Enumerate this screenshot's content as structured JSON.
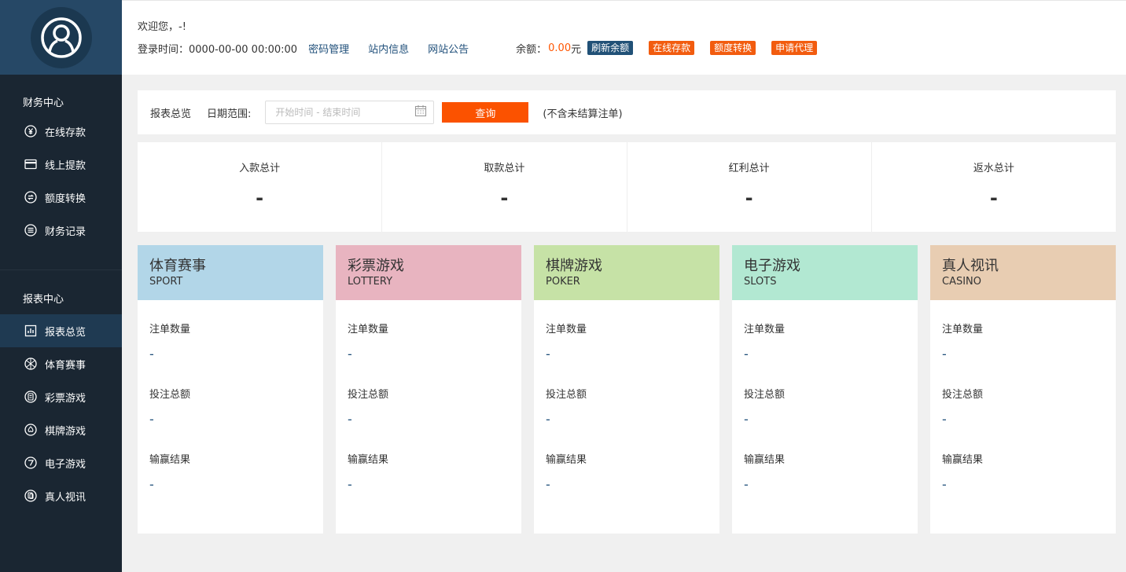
{
  "sidebar": {
    "finance_title": "财务中心",
    "finance_items": [
      {
        "label": "在线存款",
        "icon": "yen-circle-icon"
      },
      {
        "label": "线上提款",
        "icon": "card-icon"
      },
      {
        "label": "额度转换",
        "icon": "transfer-icon"
      },
      {
        "label": "财务记录",
        "icon": "list-circle-icon"
      }
    ],
    "report_title": "报表中心",
    "report_items": [
      {
        "label": "报表总览",
        "icon": "chart-icon"
      },
      {
        "label": "体育赛事",
        "icon": "ball-icon"
      },
      {
        "label": "彩票游戏",
        "icon": "lottery-icon"
      },
      {
        "label": "棋牌游戏",
        "icon": "spade-icon"
      },
      {
        "label": "电子游戏",
        "icon": "slot-icon"
      },
      {
        "label": "真人视讯",
        "icon": "casino-icon"
      }
    ]
  },
  "header": {
    "welcome": "欢迎您，-!",
    "login_time": "登录时间：0000-00-00 00:00:00",
    "links": [
      "密码管理",
      "站内信息",
      "网站公告"
    ],
    "balance_label": "余额：",
    "balance_amount": "0.00",
    "balance_unit": " 元",
    "refresh_btn": "刷新余额",
    "actions": [
      "在线存款",
      "额度转换",
      "申请代理"
    ]
  },
  "filter": {
    "title": "报表总览",
    "date_label": "日期范围:",
    "date_placeholder": "开始时间 - 结束时间",
    "query_btn": "查询",
    "note": "(不含未结算注单)"
  },
  "summary": [
    {
      "label": "入款总计",
      "value": "-"
    },
    {
      "label": "取款总计",
      "value": "-"
    },
    {
      "label": "红利总计",
      "value": "-"
    },
    {
      "label": "返水总计",
      "value": "-"
    }
  ],
  "cards": [
    {
      "title": "体育赛事",
      "sub": "SPORT",
      "color": "#b2d6e8"
    },
    {
      "title": "彩票游戏",
      "sub": "LOTTERY",
      "color": "#e8b4c0"
    },
    {
      "title": "棋牌游戏",
      "sub": "POKER",
      "color": "#c6e2a6"
    },
    {
      "title": "电子游戏",
      "sub": "SLOTS",
      "color": "#b2e8d2"
    },
    {
      "title": "真人视讯",
      "sub": "CASINO",
      "color": "#e8cdb2"
    }
  ],
  "card_stats": [
    {
      "label": "注单数量",
      "value": "-"
    },
    {
      "label": "投注总额",
      "value": "-"
    },
    {
      "label": "输赢结果",
      "value": "-"
    }
  ]
}
